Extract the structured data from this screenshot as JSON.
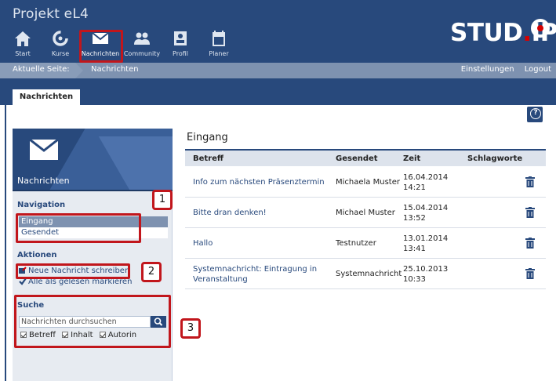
{
  "header": {
    "title": "Projekt eL4",
    "nav": [
      {
        "icon": "home-icon",
        "label": "Start"
      },
      {
        "icon": "courses-icon",
        "label": "Kurse"
      },
      {
        "icon": "envelope-icon",
        "label": "Nachrichten",
        "active": true
      },
      {
        "icon": "community-icon",
        "label": "Community"
      },
      {
        "icon": "profile-icon",
        "label": "Profil"
      },
      {
        "icon": "calendar-icon",
        "label": "Planer"
      }
    ],
    "logo_text": "STUD",
    "logo_dot": ".",
    "logo_end": "IP",
    "accent_red": "#d60000"
  },
  "breadcrumb": {
    "current_label": "Aktuelle Seite:",
    "current_page": "Nachrichten",
    "links": [
      "Einstellungen",
      "Logout"
    ]
  },
  "tabs": [
    "Nachrichten"
  ],
  "sidebar": {
    "banner_label": "Nachrichten",
    "navigation": {
      "heading": "Navigation",
      "items": [
        {
          "label": "Eingang",
          "selected": true
        },
        {
          "label": "Gesendet",
          "selected": false
        }
      ]
    },
    "actions": {
      "heading": "Aktionen",
      "items": [
        {
          "icon": "compose-icon",
          "label": "Neue Nachricht schreiben"
        },
        {
          "icon": "checkmark-icon",
          "label": "Alle als gelesen markieren"
        }
      ]
    },
    "search": {
      "heading": "Suche",
      "placeholder": "Nachrichten durchsuchen",
      "options": [
        {
          "label": "Betreff",
          "checked": true
        },
        {
          "label": "Inhalt",
          "checked": true
        },
        {
          "label": "Autorin",
          "checked": true
        }
      ]
    }
  },
  "callouts": [
    "1",
    "2",
    "3"
  ],
  "inbox": {
    "title": "Eingang",
    "columns": [
      "Betreff",
      "Gesendet",
      "Zeit",
      "Schlagworte"
    ],
    "rows": [
      {
        "subject": "Info zum nächsten Präsenztermin",
        "sender": "Michaela Muster",
        "date": "16.04.2014",
        "time": "14:21"
      },
      {
        "subject": "Bitte dran denken!",
        "sender": "Michael Muster",
        "date": "15.04.2014",
        "time": "13:52"
      },
      {
        "subject": "Hallo",
        "sender": "Testnutzer",
        "date": "13.01.2014",
        "time": "13:41"
      },
      {
        "subject": "Systemnachricht: Eintragung in Veranstaltung",
        "sender": "Systemnachricht",
        "date": "25.10.2013",
        "time": "10:33"
      }
    ]
  }
}
